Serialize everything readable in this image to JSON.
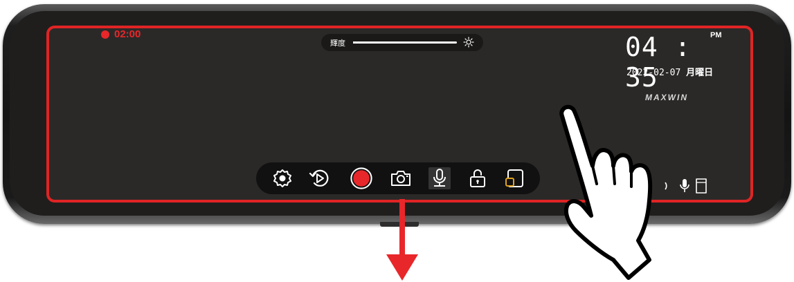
{
  "recording": {
    "time": "02:00",
    "color": "#e8272a"
  },
  "brightness": {
    "label": "輝度",
    "level": 0.9,
    "icon": "sun-icon"
  },
  "clock": {
    "time": "04 : 35",
    "ampm": "PM",
    "date": "2022-02-07",
    "weekday": "月曜日"
  },
  "brand": "MAXWIN",
  "toolbar": {
    "buttons": [
      {
        "name": "settings",
        "icon": "gear-icon"
      },
      {
        "name": "playback",
        "icon": "playback-icon"
      },
      {
        "name": "record",
        "icon": "record-icon"
      },
      {
        "name": "snapshot",
        "icon": "camera-icon"
      },
      {
        "name": "microphone",
        "icon": "microphone-icon",
        "selected": true
      },
      {
        "name": "lock",
        "icon": "lock-icon"
      },
      {
        "name": "view-switch",
        "icon": "view-switch-icon"
      }
    ]
  },
  "status_icons": [
    "mic-status-icon",
    "sd-card-icon"
  ],
  "colors": {
    "screen_border": "#e02424",
    "screen_bg": "#2b2928",
    "record": "#e8272a",
    "arrow": "#e8272a"
  }
}
